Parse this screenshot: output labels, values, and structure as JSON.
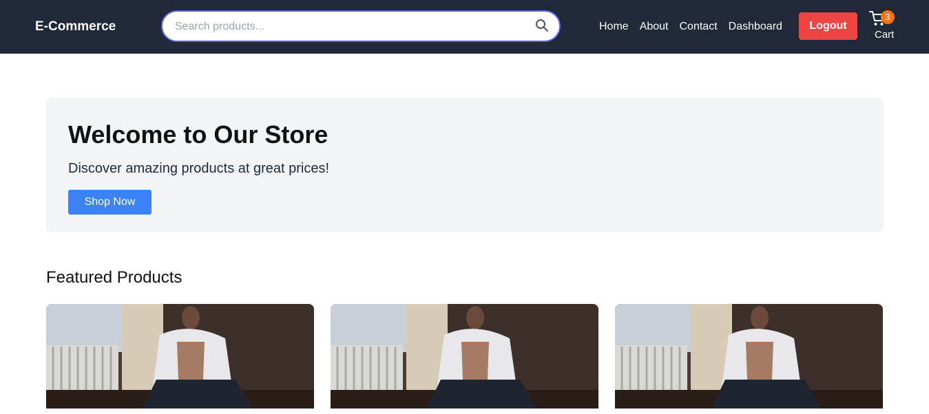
{
  "header": {
    "brand": "E-Commerce",
    "search": {
      "placeholder": "Search products...",
      "value": "",
      "icon": "search-icon"
    },
    "nav": [
      {
        "label": "Home"
      },
      {
        "label": "About"
      },
      {
        "label": "Contact"
      },
      {
        "label": "Dashboard"
      }
    ],
    "logout_label": "Logout",
    "cart": {
      "count": "3",
      "label": "Cart",
      "icon": "cart-icon"
    }
  },
  "hero": {
    "title": "Welcome to Our Store",
    "subtitle": "Discover amazing products at great prices!",
    "cta_label": "Shop Now"
  },
  "featured": {
    "title": "Featured Products",
    "products": [
      {
        "image": "man-in-white-shirt-photo"
      },
      {
        "image": "man-in-white-shirt-photo"
      },
      {
        "image": "man-in-white-shirt-photo"
      }
    ]
  },
  "colors": {
    "navbar_bg": "#1f2937",
    "search_border": "#6366f1",
    "logout_bg": "#ef4444",
    "cart_badge_bg": "#f97316",
    "hero_bg": "#f3f4f6",
    "cta_bg": "#3b82f6"
  }
}
